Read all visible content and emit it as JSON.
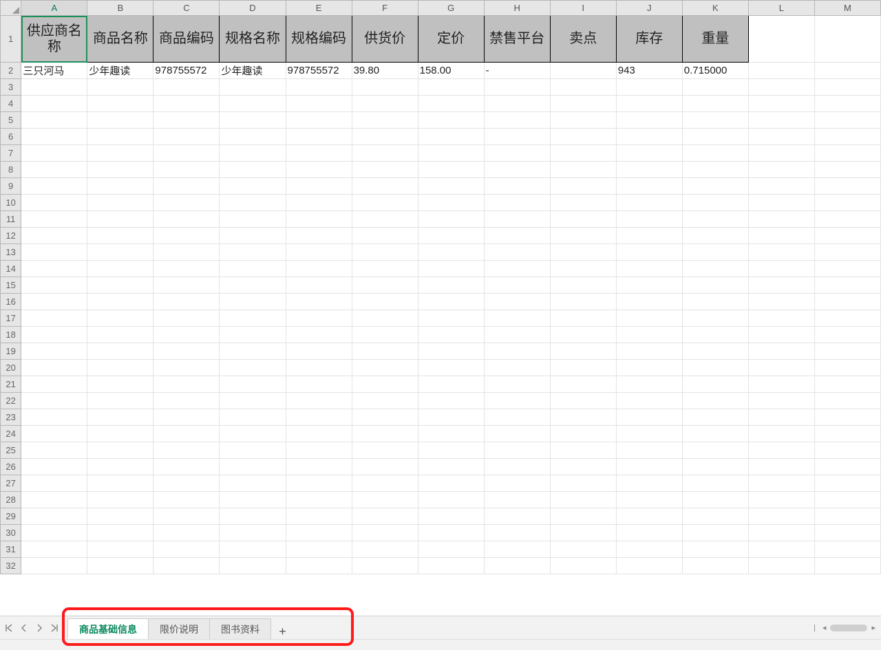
{
  "columns": [
    "A",
    "B",
    "C",
    "D",
    "E",
    "F",
    "G",
    "H",
    "I",
    "J",
    "K",
    "L",
    "M"
  ],
  "row_numbers": [
    1,
    2,
    3,
    4,
    5,
    6,
    7,
    8,
    9,
    10,
    11,
    12,
    13,
    14,
    15,
    16,
    17,
    18,
    19,
    20,
    21,
    22,
    23,
    24,
    25,
    26,
    27,
    28,
    29,
    30,
    31,
    32
  ],
  "header_row": {
    "A": "供应商名称",
    "B": "商品名称",
    "C": "商品编码",
    "D": "规格名称",
    "E": "规格编码",
    "F": "供货价",
    "G": "定价",
    "H": "禁售平台",
    "I": "卖点",
    "J": "库存",
    "K": "重量"
  },
  "data_row": {
    "A": "三只河马",
    "B": "少年趣读",
    "C": "978755572",
    "D": "少年趣读",
    "E": "978755572",
    "F": "39.80",
    "G": "158.00",
    "H": "-",
    "I": "",
    "J": "943",
    "K": "0.715000"
  },
  "sheet_tabs": [
    {
      "label": "商品基础信息",
      "active": true
    },
    {
      "label": "限价说明",
      "active": false
    },
    {
      "label": "图书资料",
      "active": false
    }
  ],
  "add_tab_glyph": "+",
  "nav": {
    "first": "|◂",
    "prev": "◂",
    "next": "▸",
    "last": "▸|"
  },
  "hscroll": {
    "left": "◂",
    "bar_right": "▸",
    "divider": "|"
  },
  "status_text": ""
}
